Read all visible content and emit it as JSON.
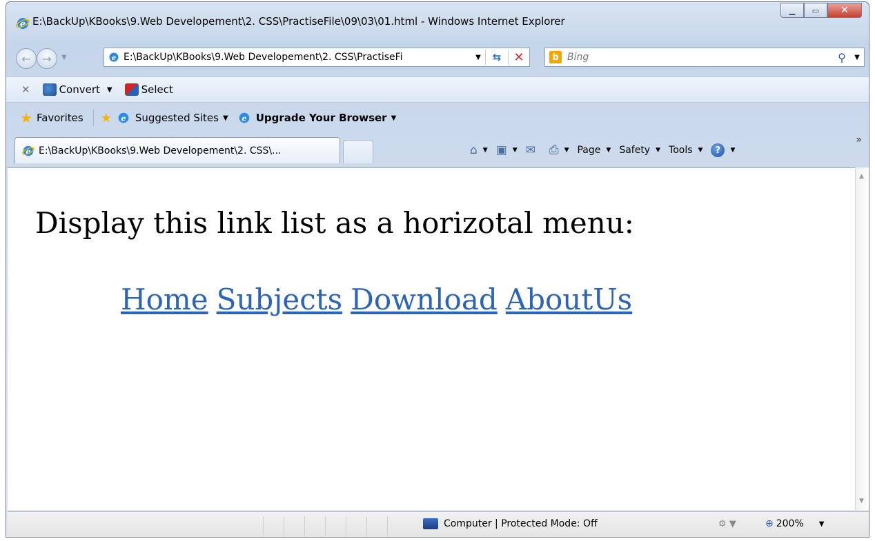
{
  "window": {
    "title": "E:\\BackUp\\KBooks\\9.Web Developement\\2. CSS\\PractiseFile\\09\\03\\01.html - Windows Internet Explorer"
  },
  "address_bar": {
    "url": "E:\\BackUp\\KBooks\\9.Web Developement\\2. CSS\\PractiseFi"
  },
  "search": {
    "placeholder": "Bing"
  },
  "command_bar": {
    "convert_label": "Convert",
    "select_label": "Select"
  },
  "favorites_bar": {
    "favorites_label": "Favorites",
    "suggested_label": "Suggested Sites",
    "upgrade_label": "Upgrade Your Browser"
  },
  "tab": {
    "title": "E:\\BackUp\\KBooks\\9.Web Developement\\2. CSS\\..."
  },
  "toolbar": {
    "page_label": "Page",
    "safety_label": "Safety",
    "tools_label": "Tools"
  },
  "page": {
    "heading": "Display this link list as a horizotal menu:",
    "menu_items": [
      "Home",
      "Subjects",
      "Download",
      "AboutUs"
    ]
  },
  "status_bar": {
    "zone_text": "Computer | Protected Mode: Off",
    "zoom": "200%"
  },
  "colors": {
    "link": "#2d64b8",
    "close_button": "#c6402f"
  }
}
